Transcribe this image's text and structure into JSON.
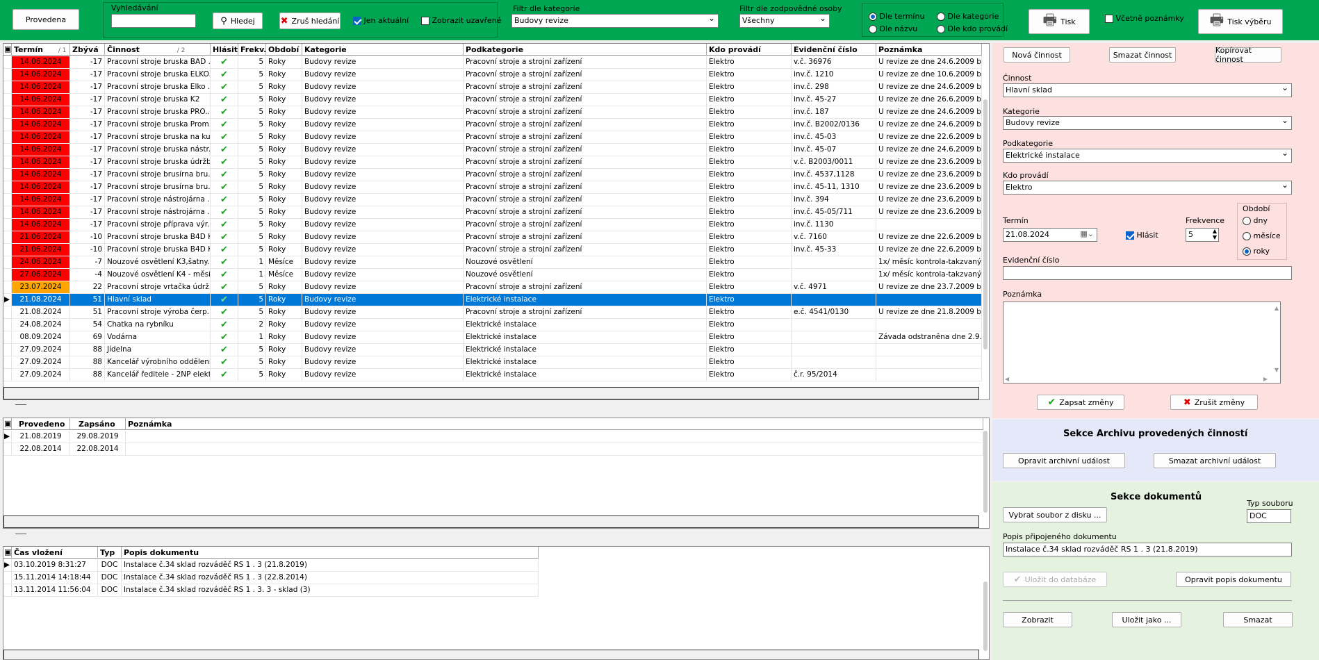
{
  "toolbar": {
    "provedena": "Provedena",
    "search_label": "Vyhledávání",
    "search_value": "",
    "hledej": "Hledej",
    "zrus_hledani": "Zruš hledání",
    "jen_aktualni": "Jen aktuální",
    "zobrazit_uzavrene": "Zobrazit uzavřené",
    "filtr_kategorie_label": "Filtr dle kategorie",
    "filtr_kategorie_value": "Budovy revize",
    "filtr_osoby_label": "Filtr dle zodpovědné osoby",
    "filtr_osoby_value": "Všechny",
    "sort_options": [
      "Dle termínu",
      "Dle kategorie",
      "Dle názvu",
      "Dle kdo provádí"
    ],
    "tisk": "Tisk",
    "vcetne_poznamky": "Včetně poznámky",
    "tisk_vyberu": "Tisk výběru"
  },
  "colors": {
    "green": "#00a651",
    "red": "#ff0000",
    "orange": "#ffa500",
    "select": "#0078d7"
  },
  "main_grid": {
    "headers": [
      "Termín",
      "Zbývá",
      "Činnost",
      "Hlásit",
      "Frekv.",
      "Období",
      "Kategorie",
      "Podkategorie",
      "Kdo provádí",
      "Evidenční číslo",
      "Poznámka"
    ],
    "sort_marks": [
      "/ 1",
      "/ 2"
    ],
    "rows": [
      {
        "termin": "14.06.2024",
        "zbyva": "-17",
        "cinnost": "Pracovní stroje bruska BAD ...",
        "frekv": "5",
        "obdobi": "Roky",
        "kategorie": "Budovy revize",
        "podkategorie": "Pracovní stroje a strojní zařízení",
        "kdo": "Elektro",
        "evid": "v.č. 36976",
        "pozn": "U revize ze dne 24.6.2009 byla",
        "color": "red"
      },
      {
        "termin": "14.06.2024",
        "zbyva": "-17",
        "cinnost": "Pracovní stroje bruska ELKO...",
        "frekv": "5",
        "obdobi": "Roky",
        "kategorie": "Budovy revize",
        "podkategorie": "Pracovní stroje a strojní zařízení",
        "kdo": "Elektro",
        "evid": "inv.č. 1210",
        "pozn": "U revize ze dne 10.6.2009 byla",
        "color": "red"
      },
      {
        "termin": "14.06.2024",
        "zbyva": "-17",
        "cinnost": "Pracovní stroje bruska Elko ...",
        "frekv": "5",
        "obdobi": "Roky",
        "kategorie": "Budovy revize",
        "podkategorie": "Pracovní stroje a strojní zařízení",
        "kdo": "Elektro",
        "evid": "inv.č. 298",
        "pozn": "U revize ze dne 24.6.2009 byla",
        "color": "red"
      },
      {
        "termin": "14.06.2024",
        "zbyva": "-17",
        "cinnost": "Pracovní stroje bruska K2",
        "frekv": "5",
        "obdobi": "Roky",
        "kategorie": "Budovy revize",
        "podkategorie": "Pracovní stroje a strojní zařízení",
        "kdo": "Elektro",
        "evid": "inv.č. 45-27",
        "pozn": "U revize ze dne 26.6.2009 byla",
        "color": "red"
      },
      {
        "termin": "14.06.2024",
        "zbyva": "-17",
        "cinnost": "Pracovní stroje bruska PRO...",
        "frekv": "5",
        "obdobi": "Roky",
        "kategorie": "Budovy revize",
        "podkategorie": "Pracovní stroje a strojní zařízení",
        "kdo": "Elektro",
        "evid": "inv.č. 187",
        "pozn": "U revize ze dne 24.6.2009 byla",
        "color": "red"
      },
      {
        "termin": "14.06.2024",
        "zbyva": "-17",
        "cinnost": "Pracovní stroje bruska Prom...",
        "frekv": "5",
        "obdobi": "Roky",
        "kategorie": "Budovy revize",
        "podkategorie": "Pracovní stroje a strojní zařízení",
        "kdo": "Elektro",
        "evid": "inv.č. B2002/0136",
        "pozn": "U revize ze dne 24.6.2009 byla",
        "color": "red"
      },
      {
        "termin": "14.06.2024",
        "zbyva": "-17",
        "cinnost": "Pracovní stroje bruska na ku...",
        "frekv": "5",
        "obdobi": "Roky",
        "kategorie": "Budovy revize",
        "podkategorie": "Pracovní stroje a strojní zařízení",
        "kdo": "Elektro",
        "evid": "inv.č. 45-03",
        "pozn": "U revize ze dne 22.6.2009 byla",
        "color": "red"
      },
      {
        "termin": "14.06.2024",
        "zbyva": "-17",
        "cinnost": "Pracovní stroje bruska nástr...",
        "frekv": "5",
        "obdobi": "Roky",
        "kategorie": "Budovy revize",
        "podkategorie": "Pracovní stroje a strojní zařízení",
        "kdo": "Elektro",
        "evid": "inv.č. 45-07",
        "pozn": "U revize ze dne 24.6.2009 byla",
        "color": "red"
      },
      {
        "termin": "14.06.2024",
        "zbyva": "-17",
        "cinnost": "Pracovní stroje bruska údržba",
        "frekv": "5",
        "obdobi": "Roky",
        "kategorie": "Budovy revize",
        "podkategorie": "Pracovní stroje a strojní zařízení",
        "kdo": "Elektro",
        "evid": "v.č. B2003/0011",
        "pozn": "U revize ze dne 23.6.2009 byla",
        "color": "red"
      },
      {
        "termin": "14.06.2024",
        "zbyva": "-17",
        "cinnost": "Pracovní stroje brusírna bru...",
        "frekv": "5",
        "obdobi": "Roky",
        "kategorie": "Budovy revize",
        "podkategorie": "Pracovní stroje a strojní zařízení",
        "kdo": "Elektro",
        "evid": "inv.č. 4537,1128",
        "pozn": "U revize ze dne 23.6.2009 byla",
        "color": "red"
      },
      {
        "termin": "14.06.2024",
        "zbyva": "-17",
        "cinnost": "Pracovní stroje brusírna bru...",
        "frekv": "5",
        "obdobi": "Roky",
        "kategorie": "Budovy revize",
        "podkategorie": "Pracovní stroje a strojní zařízení",
        "kdo": "Elektro",
        "evid": "inv.č. 45-11, 1310",
        "pozn": "U revize ze dne 23.6.2009 byla",
        "color": "red"
      },
      {
        "termin": "14.06.2024",
        "zbyva": "-17",
        "cinnost": "Pracovní stroje nástrojárna ...",
        "frekv": "5",
        "obdobi": "Roky",
        "kategorie": "Budovy revize",
        "podkategorie": "Pracovní stroje a strojní zařízení",
        "kdo": "Elektro",
        "evid": "inv.č. 394",
        "pozn": "U revize ze dne 23.6.2009 byla",
        "color": "red"
      },
      {
        "termin": "14.06.2024",
        "zbyva": "-17",
        "cinnost": "Pracovní stroje nástrojárna ...",
        "frekv": "5",
        "obdobi": "Roky",
        "kategorie": "Budovy revize",
        "podkategorie": "Pracovní stroje a strojní zařízení",
        "kdo": "Elektro",
        "evid": "inv.č. 45-05/711",
        "pozn": "U revize ze dne 23.6.2009 byla",
        "color": "red"
      },
      {
        "termin": "14.06.2024",
        "zbyva": "-17",
        "cinnost": "Pracovní stroje příprava výr...",
        "frekv": "5",
        "obdobi": "Roky",
        "kategorie": "Budovy revize",
        "podkategorie": "Pracovní stroje a strojní zařízení",
        "kdo": "Elektro",
        "evid": "inv.č. 1130",
        "pozn": "",
        "color": "red"
      },
      {
        "termin": "21.06.2024",
        "zbyva": "-10",
        "cinnost": "Pracovní stroje bruska B4D K1",
        "frekv": "5",
        "obdobi": "Roky",
        "kategorie": "Budovy revize",
        "podkategorie": "Pracovní stroje a strojní zařízení",
        "kdo": "Elektro",
        "evid": "v.č. 7160",
        "pozn": "U revize ze dne 22.6.2009 byla",
        "color": "red"
      },
      {
        "termin": "21.06.2024",
        "zbyva": "-10",
        "cinnost": "Pracovní stroje bruska B4D K1",
        "frekv": "5",
        "obdobi": "Roky",
        "kategorie": "Budovy revize",
        "podkategorie": "Pracovní stroje a strojní zařízení",
        "kdo": "Elektro",
        "evid": "inv.č. 45-33",
        "pozn": "U revize ze dne 22.6.2009 byla",
        "color": "red"
      },
      {
        "termin": "24.06.2024",
        "zbyva": "-7",
        "cinnost": "Nouzové osvětlení K3,šatny...",
        "frekv": "1",
        "obdobi": "Měsíce",
        "kategorie": "Budovy revize",
        "podkategorie": "Nouzové osvětlení",
        "kdo": "Elektro",
        "evid": "",
        "pozn": "1x/ měsíc kontrola-takzvaný fu",
        "color": "red"
      },
      {
        "termin": "27.06.2024",
        "zbyva": "-4",
        "cinnost": "Nouzové osvětlení K4 - měsí...",
        "frekv": "1",
        "obdobi": "Měsíce",
        "kategorie": "Budovy revize",
        "podkategorie": "Nouzové osvětlení",
        "kdo": "Elektro",
        "evid": "",
        "pozn": "1x/ měsíc kontrola-takzvaný fu",
        "color": "red"
      },
      {
        "termin": "23.07.2024",
        "zbyva": "22",
        "cinnost": "Pracovní stroje vrtačka údrž...",
        "frekv": "5",
        "obdobi": "Roky",
        "kategorie": "Budovy revize",
        "podkategorie": "Pracovní stroje a strojní zařízení",
        "kdo": "Elektro",
        "evid": "v.č. 4971",
        "pozn": "U revize ze dne 23.7.2009 byla",
        "color": "orange"
      },
      {
        "termin": "21.08.2024",
        "zbyva": "51",
        "cinnost": "Hlavní sklad",
        "frekv": "5",
        "obdobi": "Roky",
        "kategorie": "Budovy revize",
        "podkategorie": "Elektrické instalace",
        "kdo": "Elektro",
        "evid": "",
        "pozn": "",
        "color": "selected"
      },
      {
        "termin": "21.08.2024",
        "zbyva": "51",
        "cinnost": "Pracovní stroje výroba čerp...",
        "frekv": "5",
        "obdobi": "Roky",
        "kategorie": "Budovy revize",
        "podkategorie": "Pracovní stroje a strojní zařízení",
        "kdo": "Elektro",
        "evid": "e.č. 4541/0130",
        "pozn": "U revize ze dne 21.8.2009 byla",
        "color": ""
      },
      {
        "termin": "24.08.2024",
        "zbyva": "54",
        "cinnost": "Chatka na rybníku",
        "frekv": "2",
        "obdobi": "Roky",
        "kategorie": "Budovy revize",
        "podkategorie": "Elektrické instalace",
        "kdo": "Elektro",
        "evid": "",
        "pozn": "",
        "color": ""
      },
      {
        "termin": "08.09.2024",
        "zbyva": "69",
        "cinnost": "Vodárna",
        "frekv": "1",
        "obdobi": "Roky",
        "kategorie": "Budovy revize",
        "podkategorie": "Elektrické instalace",
        "kdo": "Elektro",
        "evid": "",
        "pozn": "Závada odstraněna dne 2.9.20",
        "color": ""
      },
      {
        "termin": "27.09.2024",
        "zbyva": "88",
        "cinnost": "Jídelna",
        "frekv": "5",
        "obdobi": "Roky",
        "kategorie": "Budovy revize",
        "podkategorie": "Elektrické instalace",
        "kdo": "Elektro",
        "evid": "",
        "pozn": "",
        "color": ""
      },
      {
        "termin": "27.09.2024",
        "zbyva": "88",
        "cinnost": "Kancelář výrobního oddělení...",
        "frekv": "5",
        "obdobi": "Roky",
        "kategorie": "Budovy revize",
        "podkategorie": "Elektrické instalace",
        "kdo": "Elektro",
        "evid": "",
        "pozn": "",
        "color": ""
      },
      {
        "termin": "27.09.2024",
        "zbyva": "88",
        "cinnost": "Kancelář ředitele - 2NP elekt...",
        "frekv": "5",
        "obdobi": "Roky",
        "kategorie": "Budovy revize",
        "podkategorie": "Elektrické instalace",
        "kdo": "Elektro",
        "evid": "č.r. 95/2014",
        "pozn": "",
        "color": ""
      }
    ]
  },
  "archive_grid": {
    "headers": [
      "Provedeno",
      "Zapsáno",
      "Poznámka"
    ],
    "rows": [
      {
        "provedeno": "21.08.2019",
        "zapsano": "29.08.2019",
        "pozn": ""
      },
      {
        "provedeno": "22.08.2014",
        "zapsano": "22.08.2014",
        "pozn": ""
      }
    ]
  },
  "docs_grid": {
    "headers": [
      "Čas vložení",
      "Typ",
      "Popis dokumentu"
    ],
    "rows": [
      {
        "cas": "03.10.2019 8:31:27",
        "typ": "DOC",
        "popis": "Instalace č.34 sklad rozváděč RS 1 . 3 (21.8.2019)"
      },
      {
        "cas": "15.11.2014 14:18:44",
        "typ": "DOC",
        "popis": "Instalace č.34 sklad rozváděč RS 1 . 3 (22.8.2014)"
      },
      {
        "cas": "13.11.2014 11:56:04",
        "typ": "DOC",
        "popis": "Instalace č.34 sklad rozváděč RS 1 . 3. 3 - sklad (3)"
      }
    ]
  },
  "detail": {
    "nova": "Nová činnost",
    "smazat": "Smazat činnost",
    "kopirovat": "Kopírovat činnost",
    "cinnost_label": "Činnost",
    "cinnost_value": "Hlavní sklad",
    "kategorie_label": "Kategorie",
    "kategorie_value": "Budovy revize",
    "podkategorie_label": "Podkategorie",
    "podkategorie_value": "Elektrické instalace",
    "kdo_label": "Kdo provádí",
    "kdo_value": "Elektro",
    "termin_label": "Termín",
    "termin_value": "21.08.2024",
    "hlasit": "Hlásit",
    "frekvence_label": "Frekvence",
    "frekvence_value": "5",
    "obdobi_label": "Období",
    "obdobi_options": [
      "dny",
      "měsíce",
      "roky"
    ],
    "evid_label": "Evidenční číslo",
    "evid_value": "",
    "poznamka_label": "Poznámka",
    "zapsat": "Zapsat změny",
    "zrusit": "Zrušit změny"
  },
  "archive_section": {
    "title": "Sekce Archivu provedených činností",
    "opravit": "Opravit archivní událost",
    "smazat": "Smazat archivní událost"
  },
  "docs_section": {
    "title": "Sekce dokumentů",
    "vybrat": "Vybrat soubor z disku ...",
    "typ_label": "Typ souboru",
    "typ_value": "DOC",
    "popis_label": "Popis připojeného dokumentu",
    "popis_value": "Instalace č.34 sklad rozváděč RS 1 . 3 (21.8.2019)",
    "ulozit_db": "Uložit do databáze",
    "opravit_popis": "Opravit popis dokumentu",
    "zobrazit": "Zobrazit",
    "ulozit_jako": "Uložit jako ...",
    "smazat": "Smazat"
  }
}
